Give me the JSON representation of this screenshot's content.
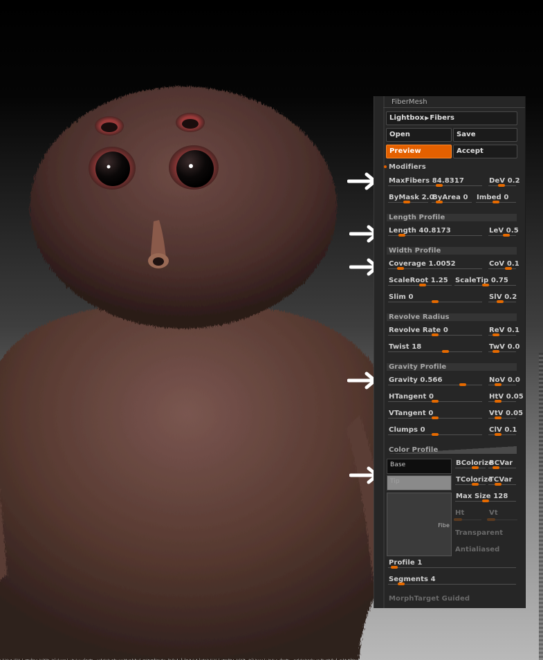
{
  "panel": {
    "title": "FiberMesh",
    "lightbox_label": "Lightbox",
    "lightbox_target": "Fibers",
    "open_label": "Open",
    "save_label": "Save",
    "preview_label": "Preview",
    "accept_label": "Accept",
    "modifiers_label": "Modifiers",
    "sections": {
      "length_profile": "Length Profile",
      "width_profile": "Width Profile",
      "revolve_radius": "Revolve Radius",
      "gravity_profile": "Gravity Profile",
      "color_profile": "Color Profile"
    },
    "sliders": {
      "maxfibers": {
        "label": "MaxFibers 84.8317",
        "level": 0.55
      },
      "dev": {
        "label": "DeV 0.2",
        "level": 0.45
      },
      "bymask": {
        "label": "ByMask 2.0",
        "level": 0.45
      },
      "byarea": {
        "label": "ByArea 0",
        "level": 0.12
      },
      "imbed": {
        "label": "Imbed 0",
        "level": 0.5
      },
      "length": {
        "label": "Length 40.8173",
        "level": 0.12
      },
      "lev": {
        "label": "LeV 0.5",
        "level": 0.7
      },
      "coverage": {
        "label": "Coverage 1.0052",
        "level": 0.1
      },
      "cov": {
        "label": "CoV 0.1",
        "level": 0.8
      },
      "scaleroot": {
        "label": "ScaleRoot 1.25",
        "level": 0.55
      },
      "scaletip": {
        "label": "ScaleTip 0.75",
        "level": 0.5
      },
      "slim": {
        "label": "Slim 0",
        "level": 0.5
      },
      "slv": {
        "label": "SlV 0.2",
        "level": 0.4
      },
      "revolve_rate": {
        "label": "Revolve Rate 0",
        "level": 0.5
      },
      "rev": {
        "label": "ReV 0.1",
        "level": 0.2
      },
      "twist": {
        "label": "Twist 18",
        "level": 0.62
      },
      "twv": {
        "label": "TwV 0.0",
        "level": 0.2
      },
      "gravity": {
        "label": "Gravity 0.566",
        "level": 0.82
      },
      "nov": {
        "label": "NoV 0.0",
        "level": 0.3
      },
      "htangent": {
        "label": "HTangent 0",
        "level": 0.5
      },
      "htv": {
        "label": "HtV 0.05",
        "level": 0.3
      },
      "vtangent": {
        "label": "VTangent 0",
        "level": 0.5
      },
      "vtv": {
        "label": "VtV 0.05",
        "level": 0.3
      },
      "clumps": {
        "label": "Clumps 0",
        "level": 0.5
      },
      "clv": {
        "label": "ClV 0.1",
        "level": 0.3
      },
      "bcolorize": {
        "label": "BColorize",
        "level": 0.7
      },
      "bcvar": {
        "label": "BCVar",
        "level": 0.2
      },
      "tcolorize": {
        "label": "TColorize",
        "level": 0.7
      },
      "tcvar": {
        "label": "TCVar",
        "level": 0.3
      },
      "maxsize": {
        "label": "Max Size 128",
        "level": 0.5
      },
      "profile": {
        "label": "Profile 1",
        "level": 0.02
      },
      "segments": {
        "label": "Segments 4",
        "level": 0.08
      }
    },
    "color": {
      "base_label": "Base",
      "tip_label": "Tip",
      "preview_label": "Fibe",
      "ht_label": "Ht",
      "vt_label": "Vt",
      "transparent_label": "Transparent",
      "antialiased_label": "Antialiased",
      "base_color": "#0e0e0e",
      "tip_color": "#8a8a8a"
    },
    "morph_label": "MorphTarget Guided",
    "accent_color": "#e46000"
  },
  "icons": [
    "right-arrow-icon",
    "triangle-right-icon"
  ]
}
